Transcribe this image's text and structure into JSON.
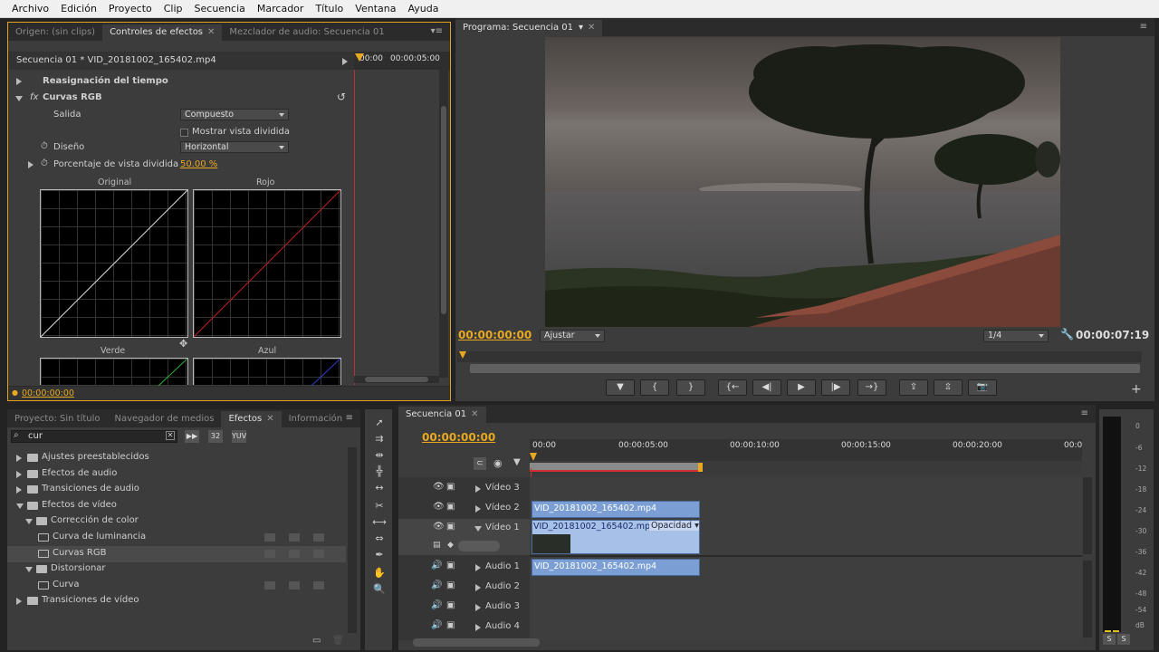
{
  "menu": [
    "Archivo",
    "Edición",
    "Proyecto",
    "Clip",
    "Secuencia",
    "Marcador",
    "Título",
    "Ventana",
    "Ayuda"
  ],
  "source_panel": {
    "tabs": [
      "Origen: (sin clips)",
      "Controles de efectos",
      "Mezclador de audio: Secuencia 01"
    ],
    "clip_path": "Secuencia 01 * VID_20181002_165402.mp4",
    "ruler_start": "00:00",
    "ruler_end": "00:00:05:00",
    "time_remap": "Reasignación del tiempo",
    "effect_name": "Curvas RGB",
    "salida_label": "Salida",
    "salida_value": "Compuesto",
    "split_view_label": "Mostrar vista dividida",
    "layout_label": "Diseño",
    "layout_value": "Horizontal",
    "split_pct_label": "Porcentaje de vista dividida",
    "split_pct_value": "50.00 %",
    "curve_labels": [
      "Original",
      "Rojo",
      "Verde",
      "Azul"
    ],
    "timecode": "00:00:00:00"
  },
  "program_panel": {
    "tab": "Programa: Secuencia 01",
    "timecode": "00:00:00:00",
    "fit": "Ajustar",
    "resolution": "1/4",
    "duration": "00:00:07:19"
  },
  "project_panel": {
    "tabs": [
      "Proyecto: Sin título",
      "Navegador de medios",
      "Efectos",
      "Información"
    ],
    "search_value": "cur",
    "tree": [
      {
        "label": "Ajustes preestablecidos",
        "level": 0,
        "exp": false
      },
      {
        "label": "Efectos de audio",
        "level": 0,
        "exp": false
      },
      {
        "label": "Transiciones de audio",
        "level": 0,
        "exp": false
      },
      {
        "label": "Efectos de vídeo",
        "level": 0,
        "exp": true
      },
      {
        "label": "Corrección de color",
        "level": 1,
        "exp": true
      },
      {
        "label": "Curva de luminancia",
        "level": 2,
        "item": true
      },
      {
        "label": "Curvas RGB",
        "level": 2,
        "item": true,
        "selected": true
      },
      {
        "label": "Distorsionar",
        "level": 1,
        "exp": true
      },
      {
        "label": "Curva",
        "level": 2,
        "item": true
      },
      {
        "label": "Transiciones de vídeo",
        "level": 0,
        "exp": false
      }
    ]
  },
  "timeline": {
    "tab": "Secuencia 01",
    "timecode": "00:00:00:00",
    "ruler": [
      "00:00",
      "00:00:05:00",
      "00:00:10:00",
      "00:00:15:00",
      "00:00:20:00",
      "00:0"
    ],
    "video_tracks": [
      "Vídeo 3",
      "Vídeo 2",
      "Vídeo 1"
    ],
    "audio_tracks": [
      "Audio 1",
      "Audio 2",
      "Audio 3",
      "Audio 4"
    ],
    "clip_name": "VID_20181002_165402.mp4",
    "opacity_label": "Opacidad"
  },
  "vu_ticks": [
    "0",
    "-6",
    "-12",
    "-18",
    "-24",
    "-30",
    "-36",
    "-42",
    "-48",
    "-54",
    "dB"
  ],
  "vu_buttons": [
    "S",
    "S"
  ]
}
